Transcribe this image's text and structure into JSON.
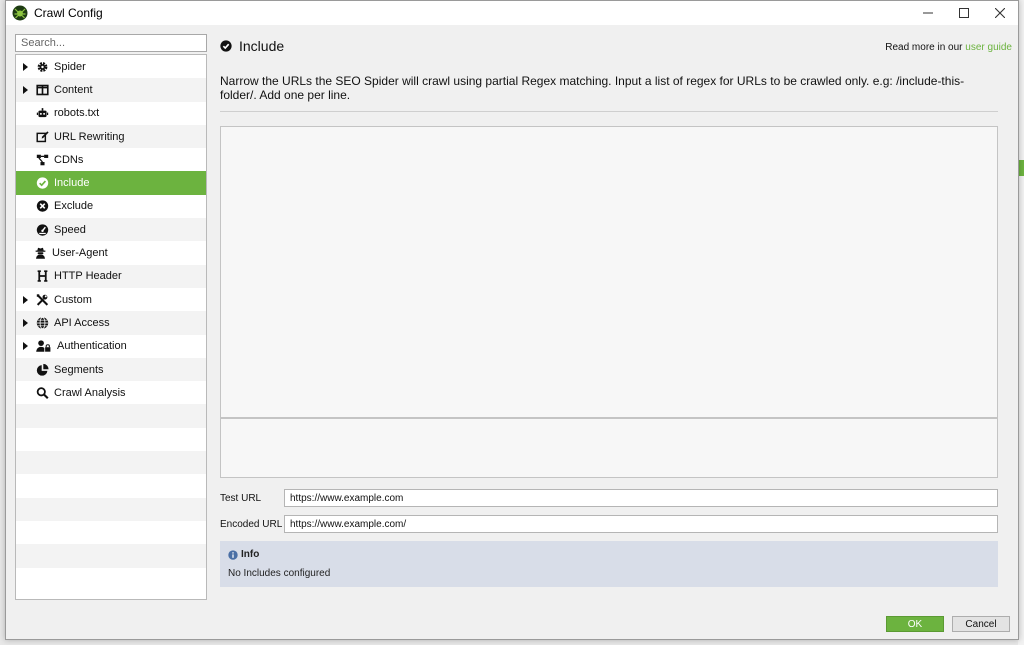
{
  "window": {
    "title": "Crawl Config",
    "icon": "spider-logo-icon"
  },
  "sidebar": {
    "search_placeholder": "Search...",
    "items": [
      {
        "label": "Spider",
        "icon": "gear-icon",
        "expandable": true,
        "active": false
      },
      {
        "label": "Content",
        "icon": "columns-icon",
        "expandable": true,
        "active": false
      },
      {
        "label": "robots.txt",
        "icon": "robot-icon",
        "expandable": false,
        "active": false
      },
      {
        "label": "URL Rewriting",
        "icon": "edit-icon",
        "expandable": false,
        "active": false
      },
      {
        "label": "CDNs",
        "icon": "network-icon",
        "expandable": false,
        "active": false
      },
      {
        "label": "Include",
        "icon": "check-circle-icon",
        "expandable": false,
        "active": true
      },
      {
        "label": "Exclude",
        "icon": "x-circle-icon",
        "expandable": false,
        "active": false
      },
      {
        "label": "Speed",
        "icon": "speedometer-icon",
        "expandable": false,
        "active": false
      },
      {
        "label": "User-Agent",
        "icon": "user-secret-icon",
        "expandable": false,
        "active": false
      },
      {
        "label": "HTTP Header",
        "icon": "h-header-icon",
        "expandable": false,
        "active": false
      },
      {
        "label": "Custom",
        "icon": "tools-icon",
        "expandable": true,
        "active": false
      },
      {
        "label": "API Access",
        "icon": "globe-icon",
        "expandable": true,
        "active": false
      },
      {
        "label": "Authentication",
        "icon": "user-lock-icon",
        "expandable": true,
        "active": false
      },
      {
        "label": "Segments",
        "icon": "pie-chart-icon",
        "expandable": false,
        "active": false
      },
      {
        "label": "Crawl Analysis",
        "icon": "magnifier-icon",
        "expandable": false,
        "active": false
      }
    ]
  },
  "main": {
    "title": "Include",
    "read_more_prefix": "Read more in our ",
    "read_more_link": "user guide",
    "description": "Narrow the URLs the SEO Spider will crawl using partial Regex matching. Input a list of regex for URLs to be crawled only. e.g: /include-this-folder/. Add one per line.",
    "regex_list_value": "",
    "test_url_label": "Test URL",
    "test_url_value": "https://www.example.com",
    "encoded_url_label": "Encoded URL",
    "encoded_url_value": "https://www.example.com/",
    "info_title": "Info",
    "info_message": "No Includes configured"
  },
  "footer": {
    "ok_label": "OK",
    "cancel_label": "Cancel"
  },
  "colors": {
    "accent": "#6cb33f",
    "info_bg": "#d8dde8"
  }
}
